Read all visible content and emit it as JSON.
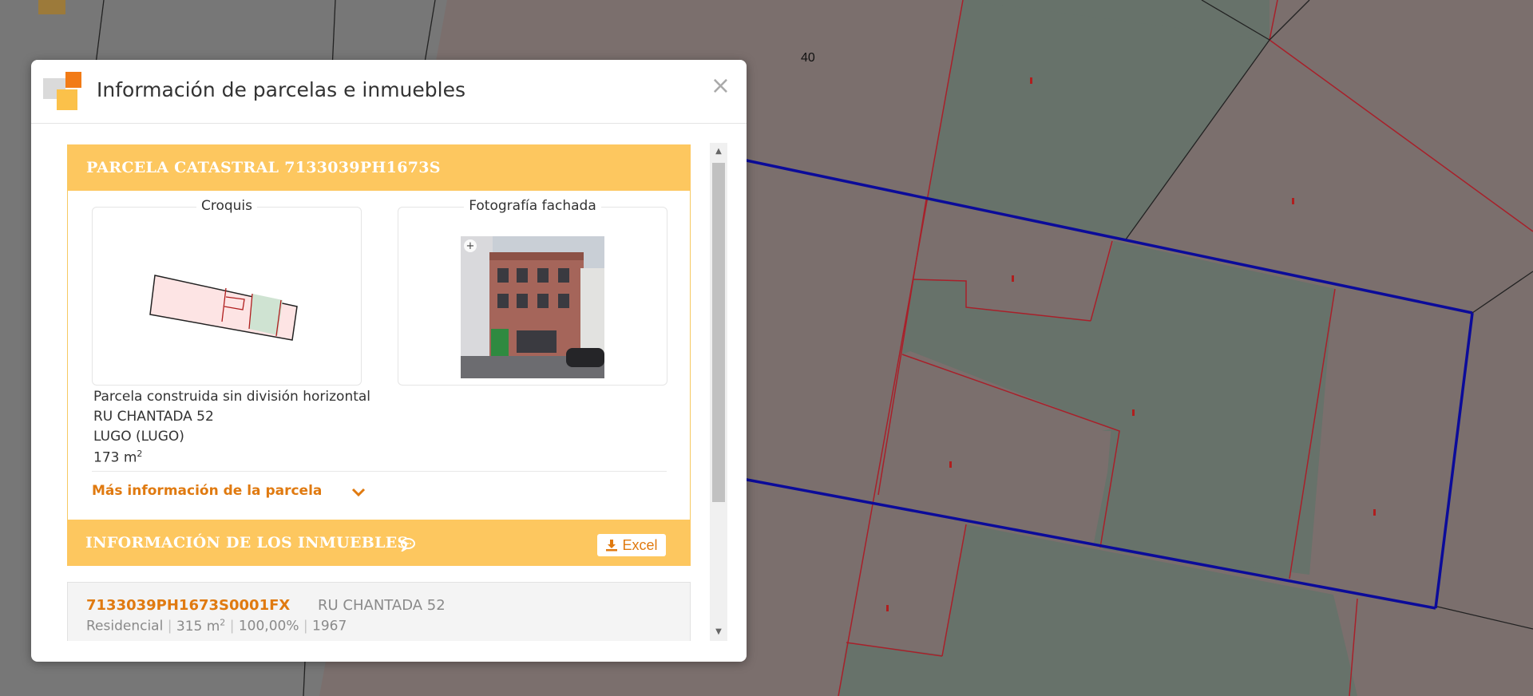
{
  "map": {
    "parcel_number": "40"
  },
  "dialog": {
    "title": "Información de parcelas e inmuebles",
    "close_label": "×"
  },
  "parcel": {
    "header": "PARCELA CATASTRAL 7133039PH1673S",
    "croquis_label": "Croquis",
    "photo_label": "Fotografía fachada",
    "type": "Parcela construida sin división horizontal",
    "address": "RU CHANTADA 52",
    "city": "LUGO (LUGO)",
    "area_value": "173 m",
    "area_unit_sup": "2",
    "more_info": "Más información de la parcela"
  },
  "properties": {
    "header": "INFORMACIÓN DE LOS INMUEBLES",
    "excel_label": "Excel",
    "items": [
      {
        "ref": "7133039PH1673S0001FX",
        "address": "RU CHANTADA 52",
        "use": "Residencial",
        "area_value": "315 m",
        "area_unit_sup": "2",
        "share": "100,00%",
        "year": "1967"
      }
    ]
  },
  "colors": {
    "accent": "#fdc75f",
    "link": "#e07a10",
    "boundary": "#0b0b9a",
    "parcel_line": "#b01e1e"
  }
}
